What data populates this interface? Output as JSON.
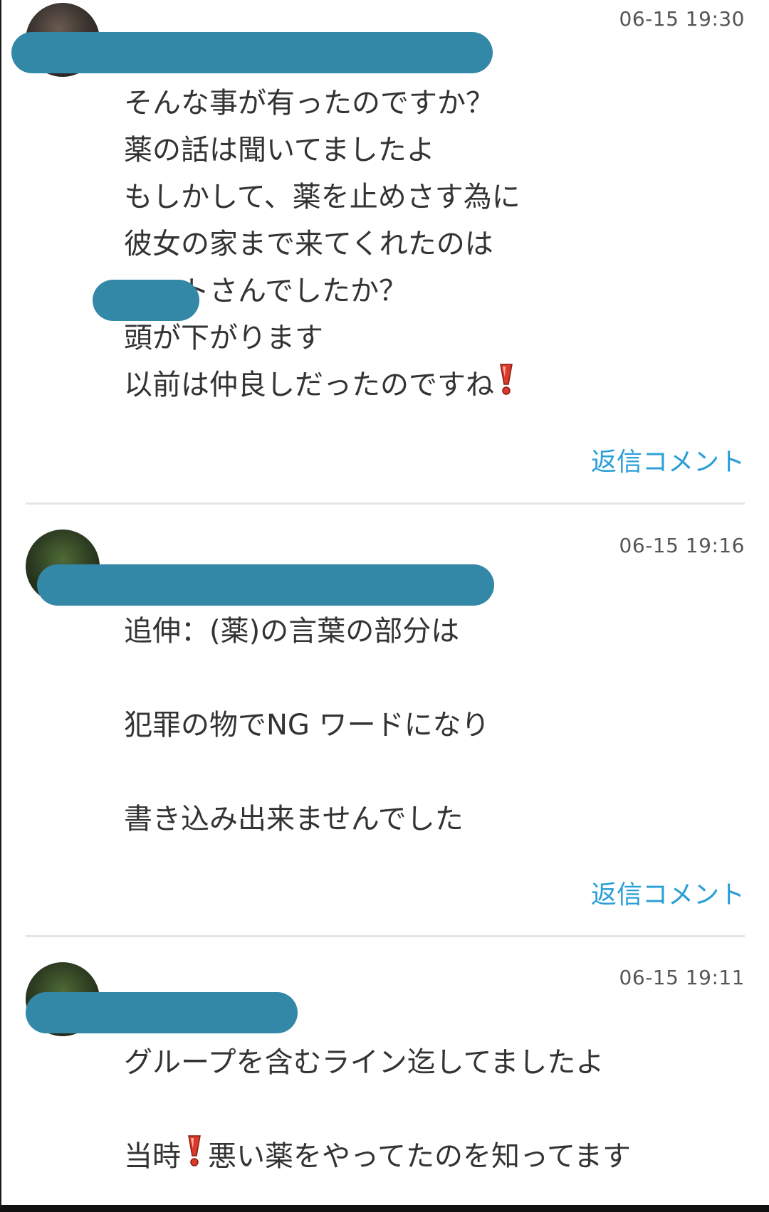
{
  "comments": [
    {
      "timestamp": "06-15 19:30",
      "lines": [
        "そんな事が有ったのですか？",
        "薬の話は聞いてましたよ",
        "もしかして、薬を止めさす為に",
        "彼女の家まで来てくれたのは",
        "　　トさんでしたか？",
        "頭が下がります",
        "以前は仲良しだったのですね"
      ],
      "reply_label": "返信コメント"
    },
    {
      "timestamp": "06-15 19:16",
      "lines": [
        "追伸：(薬)の言葉の部分は",
        "",
        "犯罪の物でNG ワードになり",
        "",
        "書き込み出来ませんでした"
      ],
      "reply_label": "返信コメント"
    },
    {
      "timestamp": "06-15 19:11",
      "lines": [
        "グループを含むライン迄してましたよ",
        "",
        "当時",
        "悪い薬をやってたのを知ってます"
      ]
    }
  ],
  "colors": {
    "redaction": "#3388a8",
    "reply_link": "#2a9fd6",
    "divider": "#e5e5e5",
    "emoji_exclamation": "#d93a2b"
  },
  "icons": {
    "exclamation": "red-exclamation-icon"
  }
}
